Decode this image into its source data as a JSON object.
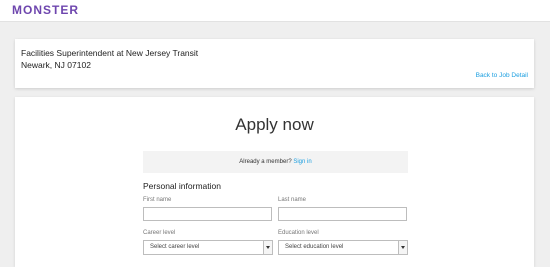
{
  "header": {
    "logo": "MONSTER"
  },
  "job": {
    "title": "Facilities Superintendent at New Jersey Transit",
    "location": "Newark, NJ 07102",
    "back_link": "Back to Job Detail"
  },
  "form": {
    "heading": "Apply now",
    "member_prompt": "Already a member?",
    "sign_in_label": "Sign in",
    "section_title": "Personal information",
    "first_name_label": "First name",
    "last_name_label": "Last name",
    "career_level_label": "Career level",
    "career_level_value": "Select career level",
    "education_level_label": "Education level",
    "education_level_value": "Select education level"
  },
  "colors": {
    "brand": "#6e46ae",
    "link": "#1a9ee0"
  }
}
